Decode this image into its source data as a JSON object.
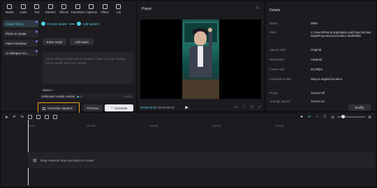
{
  "toolbar": {
    "items": [
      {
        "label": "Media",
        "icon": "media-icon"
      },
      {
        "label": "Audio",
        "icon": "audio-icon"
      },
      {
        "label": "Text",
        "icon": "text-icon"
      },
      {
        "label": "Stickers",
        "icon": "stickers-icon"
      },
      {
        "label": "Effects",
        "icon": "effects-icon"
      },
      {
        "label": "Transitions",
        "icon": "transitions-icon"
      },
      {
        "label": "Captions",
        "icon": "captions-icon"
      },
      {
        "label": "Filters",
        "icon": "filters-icon"
      },
      {
        "label": "Adj",
        "icon": "adjust-icon"
      }
    ]
  },
  "sidebar": {
    "items": [
      {
        "label": "Avatar library"
      },
      {
        "label": "Photo to avatar"
      },
      {
        "label": "Video translator"
      },
      {
        "label": "AI dialogue sce..."
      }
    ]
  },
  "steps": {
    "step1": "Choose avatar",
    "step2": "Add speech"
  },
  "script": {
    "enter_script": "Enter script",
    "add_audio": "Add audio",
    "placeholder": "Enter what you want the AI avatar to read. You can change the AI avatar and voice below."
  },
  "voice": {
    "label": "Weirre"
  },
  "credits": {
    "label": "Estimated credits needed",
    "value": "1",
    "limit": "Limit 0"
  },
  "actions": {
    "generate_captions": "Generate captions",
    "previous": "Previous",
    "generate": "Generate"
  },
  "player": {
    "title": "Player",
    "current_time": "00:00:00:00",
    "duration": "00:00:06:00"
  },
  "details": {
    "title": "Details",
    "rows": [
      {
        "key": "Name:",
        "value": "0905"
      },
      {
        "key": "Path:",
        "value": "C:/Users/PMLS/AppData/Local/CapCut/User Data/Projects/com.lveditor.draft/0905"
      },
      {
        "key": "Aspect ratio:",
        "value": "Original"
      },
      {
        "key": "Resolution:",
        "value": "Adapted"
      },
      {
        "key": "Frame rate:",
        "value": "30.00fps"
      },
      {
        "key": "Imported media:",
        "value": "Stay in original location"
      },
      {
        "key": "Proxy:",
        "value": "Turned off"
      },
      {
        "key": "Arrange layers:",
        "value": "Turned on"
      }
    ],
    "modify": "Modify"
  },
  "timeline": {
    "ruler": [
      "00:00",
      "100:00",
      "100:00",
      "100:00",
      "100:00"
    ],
    "drop_hint": "Drag material here and start to create"
  },
  "colors": {
    "accent": "#4fd1e6",
    "highlight": "#f0a51e",
    "panel": "#1c1c20"
  }
}
